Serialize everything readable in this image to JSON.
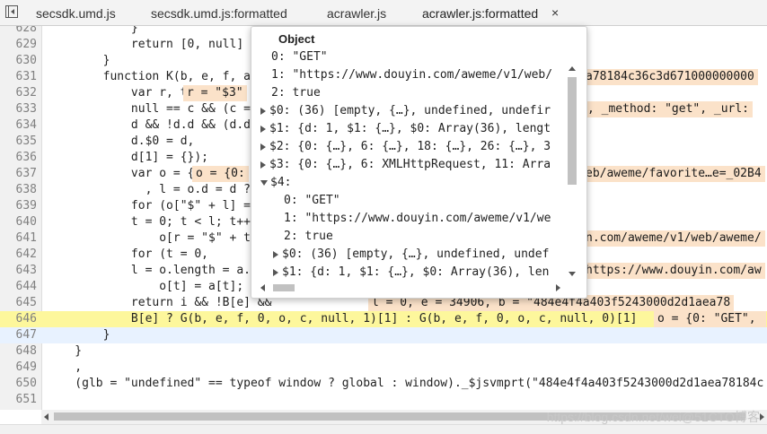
{
  "tabs": [
    {
      "label": "secsdk.umd.js"
    },
    {
      "label": "secsdk.umd.js:formatted"
    },
    {
      "label": "acrawler.js"
    },
    {
      "label": "acrawler.js:formatted",
      "active": true
    }
  ],
  "tab_close_glyph": "×",
  "code_lines": [
    {
      "n": "628",
      "t": "            }"
    },
    {
      "n": "629",
      "t": "            return [0, null]"
    },
    {
      "n": "630",
      "t": "        }"
    },
    {
      "n": "631",
      "t": "        function K(b, e, f, a, c"
    },
    {
      "n": "632",
      "t": "            var r, t;"
    },
    {
      "n": "633",
      "t": "            null == c && (c = th"
    },
    {
      "n": "634",
      "t": "            d && !d.d && (d.d ="
    },
    {
      "n": "635",
      "t": "            d.$0 = d,"
    },
    {
      "n": "636",
      "t": "            d[1] = {});"
    },
    {
      "n": "637",
      "t": "            var o = {}"
    },
    {
      "n": "638",
      "t": "              , l = o.d = d ? d."
    },
    {
      "n": "639",
      "t": "            for (o[\"$\" + l] = o,"
    },
    {
      "n": "640",
      "t": "            t = 0; t < l; t++)"
    },
    {
      "n": "641",
      "t": "                o[r = \"$\" + t] ="
    },
    {
      "n": "642",
      "t": "            for (t = 0,"
    },
    {
      "n": "643",
      "t": "            l = o.length = a.len"
    },
    {
      "n": "644",
      "t": "                o[t] = a[t];"
    },
    {
      "n": "645",
      "t": "            return i && !B[e] &&"
    },
    {
      "n": "646",
      "t": "            B[e] ? G(b, e, f, 0, o, c, null, 1)[1] : G(b, e, f, 0, o, c, null, 0)[1]"
    },
    {
      "n": "647",
      "t": "        }"
    },
    {
      "n": "648",
      "t": "    }"
    },
    {
      "n": "649",
      "t": "    ,"
    },
    {
      "n": "650",
      "t": "    (glb = \"undefined\" == typeof window ? global : window)._$jsvmprt(\"484e4f4a403f5243000d2d1aea78184c"
    },
    {
      "n": "651",
      "t": ""
    }
  ],
  "inline_values": {
    "l631": "a78184c36c3d671000000000",
    "l632": "r = \"$3\"",
    "l633": ", _method: \"get\", _url:",
    "l637": "o = {0:",
    "l637b": "eb/aweme/favorite…e=_02B4",
    "l641": "n.com/aweme/v1/web/aweme/",
    "l643": "https://www.douyin.com/aw",
    "l645": "l = 0, e = 34906, b = \"484e4f4a403f5243000d2d1aea78",
    "l646": "o = {0: \"GET\", "
  },
  "popover": {
    "title": "Object",
    "rows": [
      {
        "text": "0: \"GET\""
      },
      {
        "text": "1: \"https://www.douyin.com/aweme/v1/web/"
      },
      {
        "text": "2: true"
      },
      {
        "text": "$0: (36) [empty, {…}, undefined, undefir"
      },
      {
        "text": "$1: {d: 1, $1: {…}, $0: Array(36), lengt"
      },
      {
        "text": "$2: {0: {…}, 6: {…}, 18: {…}, 26: {…}, 3"
      },
      {
        "text": "$3: {0: {…}, 6: XMLHttpRequest, 11: Arra"
      },
      {
        "text": "$4:"
      },
      {
        "text": "0: \"GET\""
      },
      {
        "text": "1: \"https://www.douyin.com/aweme/v1/we"
      },
      {
        "text": "2: true"
      },
      {
        "text": "$0: (36) [empty, {…}, undefined, undef"
      },
      {
        "text": "$1: {d: 1, $1: {…}, $0: Array(36), len"
      }
    ]
  },
  "watermark": "https://blog.csdn.net/wei@51CTO博客"
}
